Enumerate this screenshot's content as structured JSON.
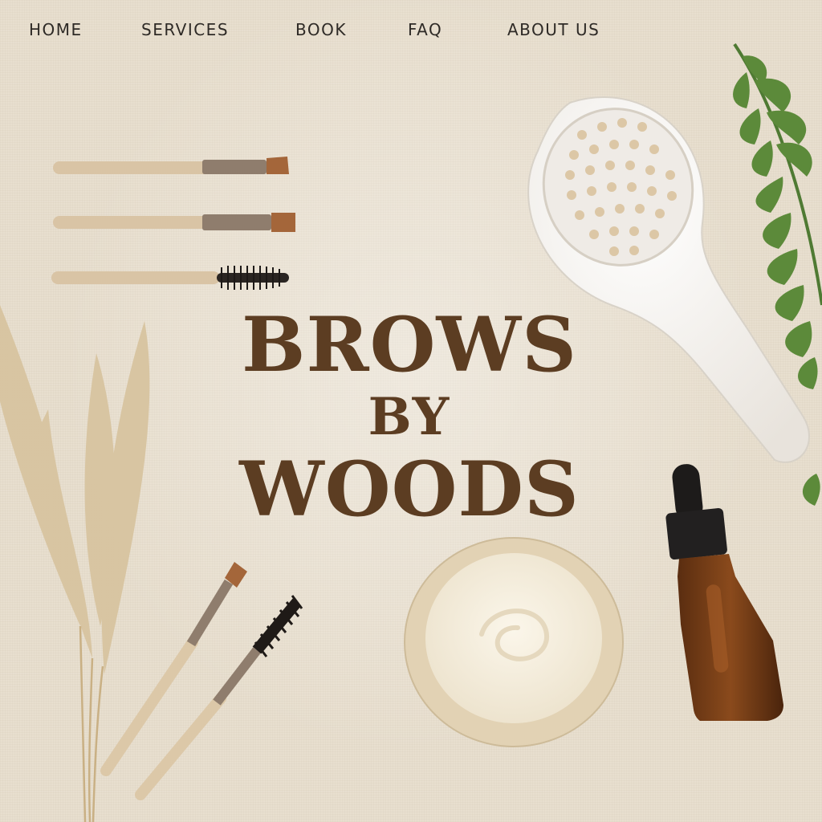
{
  "nav": {
    "items": [
      {
        "label": "HOME"
      },
      {
        "label": "SERVICES"
      },
      {
        "label": "BOOK"
      },
      {
        "label": "FAQ"
      },
      {
        "label": "ABOUT US"
      }
    ]
  },
  "hero": {
    "line1": "BROWS",
    "line2": "BY",
    "line3": "WOODS"
  },
  "colors": {
    "background": "#e8dfcf",
    "title": "#5c3d22",
    "nav_text": "#2e2a26"
  }
}
